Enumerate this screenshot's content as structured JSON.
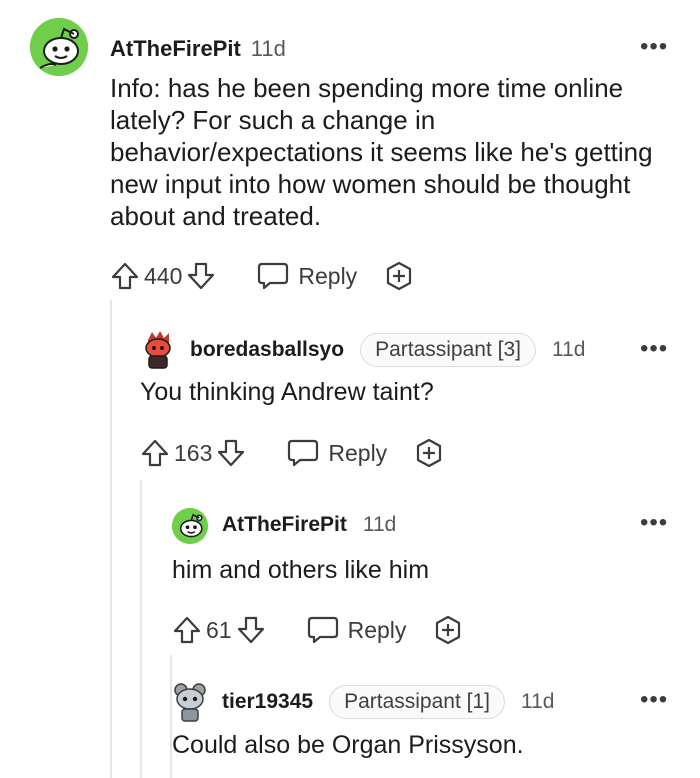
{
  "comments": [
    {
      "username": "AtTheFirePit",
      "time": "11d",
      "flair": "",
      "body": "Info: has he been spending more time online lately? For such a change in behavior/expectations it seems like he's getting new input into how women should be thought about and treated.",
      "votes": "440",
      "reply_label": "Reply",
      "more_label": "•••",
      "avatar_color": "#6fcf4a"
    },
    {
      "username": "boredasballsyo",
      "time": "11d",
      "flair": "Partassipant [3]",
      "body": "You thinking Andrew taint?",
      "votes": "163",
      "reply_label": "Reply",
      "more_label": "•••",
      "avatar_color": "#c0392b"
    },
    {
      "username": "AtTheFirePit",
      "time": "11d",
      "flair": "",
      "body": "him and others like him",
      "votes": "61",
      "reply_label": "Reply",
      "more_label": "•••",
      "avatar_color": "#6fcf4a"
    },
    {
      "username": "tier19345",
      "time": "11d",
      "flair": "Partassipant [1]",
      "body": "Could also be Organ Prissyson.",
      "votes": "",
      "reply_label": "",
      "more_label": "•••",
      "avatar_color": "#8a96a0"
    }
  ],
  "icons": {
    "upvote": "upvote-icon",
    "downvote": "downvote-icon",
    "reply": "reply-bubble-icon",
    "award": "award-plus-icon",
    "more": "more-options-icon"
  }
}
